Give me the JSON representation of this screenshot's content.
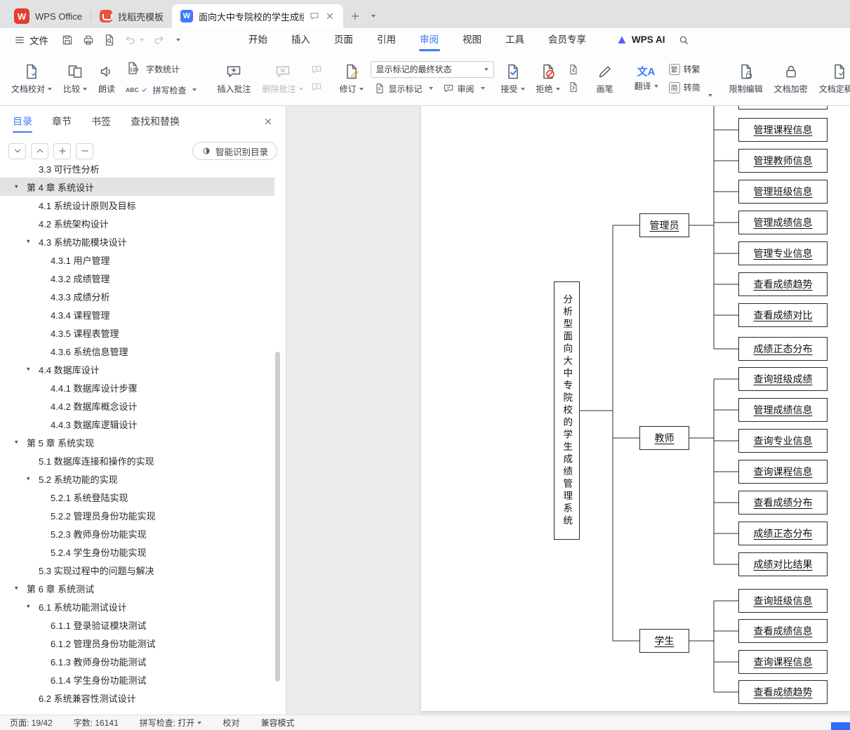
{
  "window": {
    "logo_letter": "W",
    "tabs": [
      {
        "label": "WPS Office"
      },
      {
        "label": "找稻壳模板"
      },
      {
        "label": "面向大中专院校的学生成绩管"
      }
    ]
  },
  "menubar": {
    "file": "文件",
    "tabs": [
      "开始",
      "插入",
      "页面",
      "引用",
      "审阅",
      "视图",
      "工具",
      "会员专享"
    ],
    "wps_ai": "WPS AI"
  },
  "ribbon": {
    "doc_proofing": "文档校对",
    "compare": "比较",
    "read_aloud": "朗读",
    "word_count": "字数统计",
    "spell_check": "拼写检查",
    "insert_comment": "插入批注",
    "delete_comment": "删除批注",
    "track_changes": "修订",
    "markup_final": "显示标记的最终状态",
    "show_markup": "显示标记",
    "review": "审阅",
    "accept": "接受",
    "reject": "拒绝",
    "brush": "画笔",
    "translate": "翻译",
    "to_traditional": "转繁",
    "to_simplified": "转简",
    "restrict_edit": "限制编辑",
    "encrypt": "文档加密",
    "finalize": "文档定稿",
    "count_glyph": "123",
    "abc_glyph": "ABC",
    "translate_glyph": "文A",
    "trad_glyph": "繁",
    "simp_glyph": "简"
  },
  "sidebar": {
    "tabs": [
      "目录",
      "章节",
      "书签",
      "查找和替换"
    ],
    "smart_toc": "智能识别目录",
    "toc": [
      "3.3 可行性分析",
      "第 4 章 系统设计",
      "4.1 系统设计原则及目标",
      "4.2 系统架构设计",
      "4.3 系统功能模块设计",
      "4.3.1 用户管理",
      "4.3.2 成绩管理",
      "4.3.3 成绩分析",
      "4.3.4 课程管理",
      "4.3.5 课程表管理",
      "4.3.6 系统信息管理",
      "4.4 数据库设计",
      "4.4.1 数据库设计步骤",
      "4.4.2 数据库概念设计",
      "4.4.3 数据库逻辑设计",
      "第 5 章 系统实现",
      "5.1 数据库连接和操作的实现",
      "5.2 系统功能的实现",
      "5.2.1 系统登陆实现",
      "5.2.2 管理员身份功能实现",
      "5.2.3 教师身份功能实现",
      "5.2.4 学生身份功能实现",
      "5.3 实现过程中的问题与解决",
      "第 6 章 系统测试",
      "6.1 系统功能测试设计",
      "6.1.1 登录验证模块测试",
      "6.1.2 管理员身份功能测试",
      "6.1.3 教师身份功能测试",
      "6.1.4 学生身份功能测试",
      "6.2 系统兼容性测试设计"
    ]
  },
  "diagram": {
    "root": "分析型面向大中专院校的学生成绩管理系统",
    "roles": [
      {
        "name": "管理员",
        "functions": [
          "管理课程信息",
          "管理教师信息",
          "管理班级信息",
          "管理成绩信息",
          "管理专业信息",
          "查看成绩趋势",
          "查看成绩对比",
          "成绩正态分布"
        ]
      },
      {
        "name": "教师",
        "functions": [
          "查询班级成绩",
          "管理成绩信息",
          "查询专业信息",
          "查询课程信息",
          "查看成绩分布",
          "成绩正态分布",
          "成绩对比结果"
        ]
      },
      {
        "name": "学生",
        "functions": [
          "查询班级信息",
          "查看成绩信息",
          "查询课程信息",
          "查看成绩趋势"
        ]
      }
    ]
  },
  "statusbar": {
    "page": "页面: 19/42",
    "words": "字数: 16141",
    "spell": "拼写检查: 打开",
    "proofread": "校对",
    "compat": "兼容模式"
  }
}
